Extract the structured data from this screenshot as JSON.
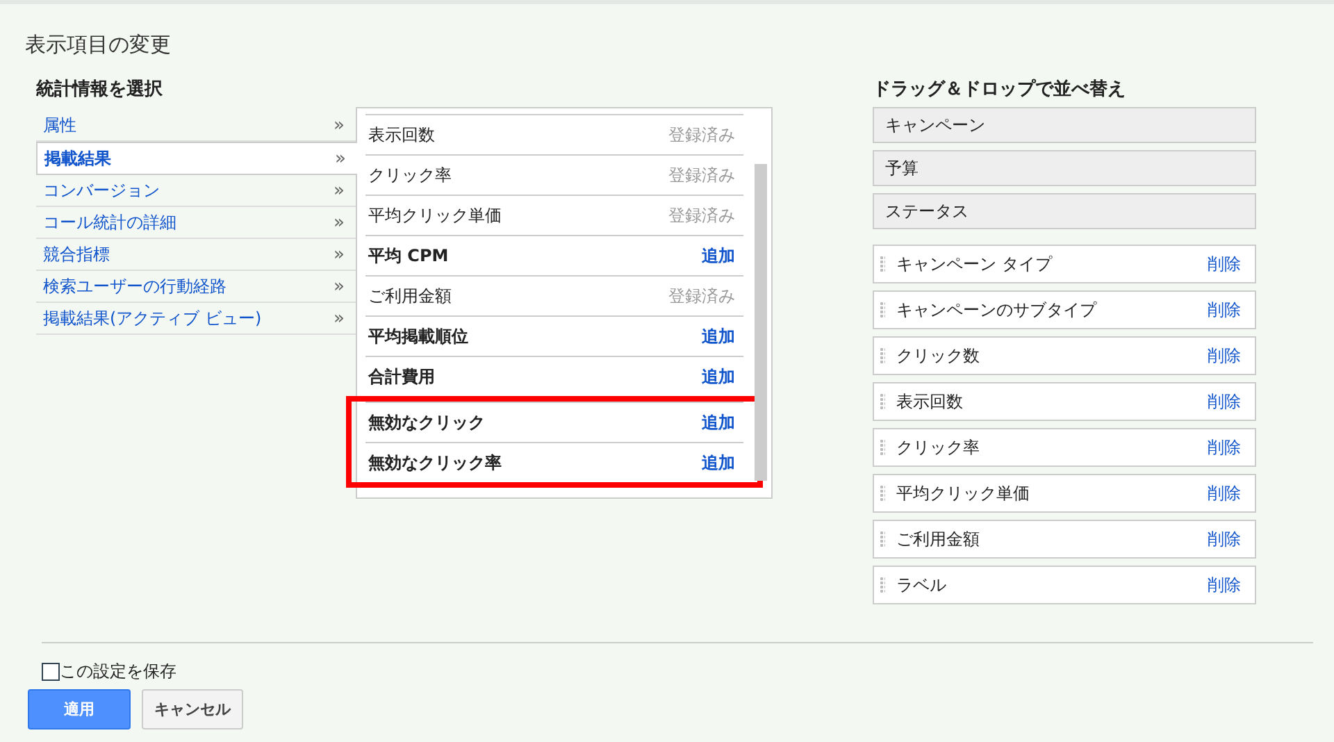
{
  "title": "表示項目の変更",
  "select_heading": "統計情報を選択",
  "categories": [
    {
      "label": "属性",
      "selected": false,
      "chevron": "»"
    },
    {
      "label": "掲載結果",
      "selected": true,
      "chevron": "»"
    },
    {
      "label": "コンバージョン",
      "selected": false,
      "chevron": "»"
    },
    {
      "label": "コール統計の詳細",
      "selected": false,
      "chevron": "»"
    },
    {
      "label": "競合指標",
      "selected": false,
      "chevron": "»"
    },
    {
      "label": "検索ユーザーの行動経路",
      "selected": false,
      "chevron": "»"
    },
    {
      "label": "掲載結果(アクティブ ビュー)",
      "selected": false,
      "chevron": "»"
    }
  ],
  "metrics": [
    {
      "name": "表示回数",
      "registered": true,
      "action": "登録済み",
      "highlighted": false
    },
    {
      "name": "クリック率",
      "registered": true,
      "action": "登録済み",
      "highlighted": false
    },
    {
      "name": "平均クリック単価",
      "registered": true,
      "action": "登録済み",
      "highlighted": false
    },
    {
      "name": "平均 CPM",
      "registered": false,
      "action": "追加",
      "highlighted": false
    },
    {
      "name": "ご利用金額",
      "registered": true,
      "action": "登録済み",
      "highlighted": false
    },
    {
      "name": "平均掲載順位",
      "registered": false,
      "action": "追加",
      "highlighted": false
    },
    {
      "name": "合計費用",
      "registered": false,
      "action": "追加",
      "highlighted": false
    },
    {
      "name": "無効なクリック",
      "registered": false,
      "action": "追加",
      "highlighted": true
    },
    {
      "name": "無効なクリック率",
      "registered": false,
      "action": "追加",
      "highlighted": true
    }
  ],
  "order_heading": "ドラッグ＆ドロップで並べ替え",
  "fixed_columns": [
    "キャンペーン",
    "予算",
    "ステータス"
  ],
  "columns": [
    {
      "name": "キャンペーン タイプ",
      "remove": "削除"
    },
    {
      "name": "キャンペーンのサブタイプ",
      "remove": "削除"
    },
    {
      "name": "クリック数",
      "remove": "削除"
    },
    {
      "name": "表示回数",
      "remove": "削除"
    },
    {
      "name": "クリック率",
      "remove": "削除"
    },
    {
      "name": "平均クリック単価",
      "remove": "削除"
    },
    {
      "name": "ご利用金額",
      "remove": "削除"
    },
    {
      "name": "ラベル",
      "remove": "削除"
    }
  ],
  "save_setting": {
    "label": "この設定を保存",
    "checked": false
  },
  "buttons": {
    "apply": "適用",
    "cancel": "キャンセル"
  }
}
